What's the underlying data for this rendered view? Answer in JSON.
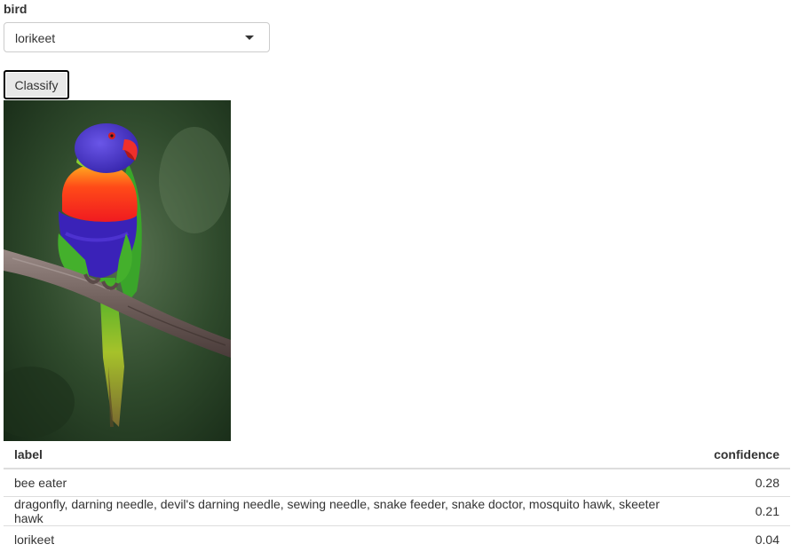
{
  "form": {
    "field_label": "bird",
    "select": {
      "value": "lorikeet",
      "caret_icon": "chevron-down-icon"
    },
    "classify_label": "Classify"
  },
  "photo": {
    "subject": "rainbow lorikeet perched on branch",
    "colors": {
      "background": "#2e4a2a",
      "head": "#4a2fc4",
      "breast": "#ff5a1a",
      "belly": "#3a22b8",
      "wing": "#3fae2a",
      "tail": "#9ec02a",
      "beak": "#e8202a",
      "branch": "#7a6a66"
    }
  },
  "results": {
    "headers": {
      "label": "label",
      "confidence": "confidence"
    },
    "rows": [
      {
        "label": "bee eater",
        "confidence": "0.28"
      },
      {
        "label": "dragonfly, darning needle, devil's darning needle, sewing needle, snake feeder, snake doctor, mosquito hawk, skeeter hawk",
        "confidence": "0.21"
      },
      {
        "label": "lorikeet",
        "confidence": "0.04"
      }
    ]
  }
}
